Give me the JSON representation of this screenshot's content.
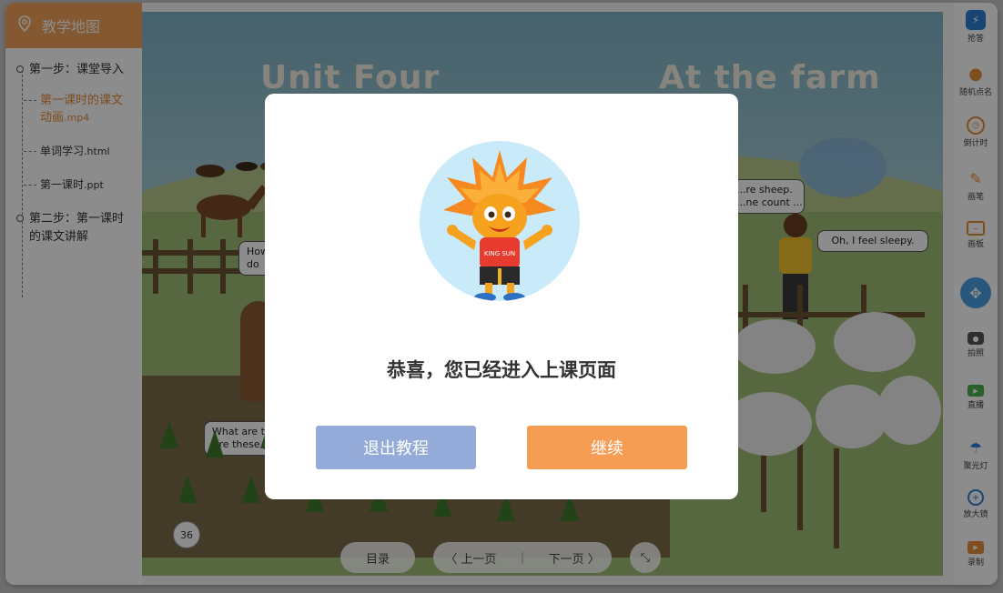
{
  "sidebar": {
    "title": "教学地图",
    "steps": [
      {
        "label": "第一步：课堂导入"
      },
      {
        "label": "第二步：第一课时的课文讲解"
      }
    ],
    "items": [
      {
        "label": "第一课时的课文动画",
        "ext": ".mp4",
        "active": true
      },
      {
        "label": "单词学习",
        "ext": ".html",
        "active": false
      },
      {
        "label": "第一课时",
        "ext": ".ppt",
        "active": false
      }
    ]
  },
  "slide": {
    "title_left": "Unit Four",
    "title_right": "At the farm",
    "bubbles": {
      "sheep": "...re sheep.\n...ne count ...",
      "sleepy": "Oh, I feel sleepy.",
      "how": "How\ndo",
      "what": "What are t\nAre these po"
    },
    "page_number": "36"
  },
  "bottom_nav": {
    "menu": "目录",
    "prev": "上一页",
    "next": "下一页"
  },
  "toolbar": {
    "items": [
      {
        "label": "抢答",
        "icon": "lightning-icon"
      },
      {
        "label": "随机点名",
        "icon": "person-icon"
      },
      {
        "label": "倒计时",
        "icon": "stopwatch-icon"
      },
      {
        "label": "画笔",
        "icon": "pen-icon"
      },
      {
        "label": "画板",
        "icon": "board-icon"
      },
      {
        "label": "拍照",
        "icon": "camera-icon"
      },
      {
        "label": "直播",
        "icon": "video-icon"
      },
      {
        "label": "聚光灯",
        "icon": "spotlight-icon"
      },
      {
        "label": "放大镜",
        "icon": "magnifier-icon"
      },
      {
        "label": "录制",
        "icon": "clapper-icon"
      }
    ]
  },
  "modal": {
    "mascot_badge": "KING SUN",
    "message": "恭喜，您已经进入上课页面",
    "exit_label": "退出教程",
    "continue_label": "继续"
  },
  "colors": {
    "accent_orange": "#f59e53",
    "exit_blue": "#94abd9",
    "active_item": "#e98b3a",
    "sidebar_header": "#f0a35a"
  }
}
